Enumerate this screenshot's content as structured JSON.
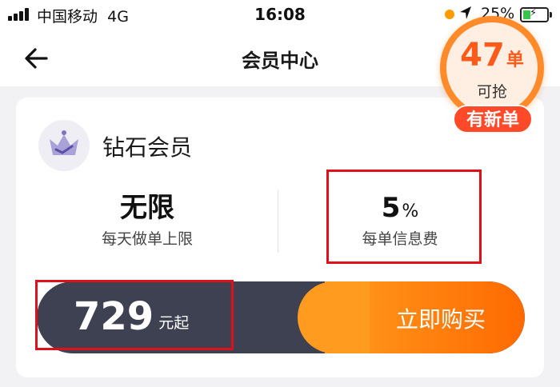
{
  "status_bar": {
    "carrier": "中国移动",
    "network": "4G",
    "time": "16:08",
    "battery": "25%",
    "icons": [
      "signal-icon",
      "location-icon",
      "battery-charging-icon"
    ]
  },
  "nav": {
    "title": "会员中心",
    "back_icon": "arrow-left-icon"
  },
  "member": {
    "tier_name": "钻石会员",
    "tier_icon": "crown-icon",
    "stats": [
      {
        "value": "无限",
        "unit": "",
        "label": "每天做单上限"
      },
      {
        "value": "5",
        "unit": "%",
        "label": "每单信息费"
      }
    ]
  },
  "purchase": {
    "price": "729",
    "price_suffix": "元起",
    "button_label": "立即购买"
  },
  "floating_badge": {
    "count": "47",
    "count_unit": "单",
    "subtitle": "可抢",
    "pill_label": "有新单"
  },
  "colors": {
    "accent_orange": "#ff7a00",
    "bar_dark": "#3e4152",
    "badge_red": "#ff4a2a",
    "annotation_red": "#e0101a"
  }
}
